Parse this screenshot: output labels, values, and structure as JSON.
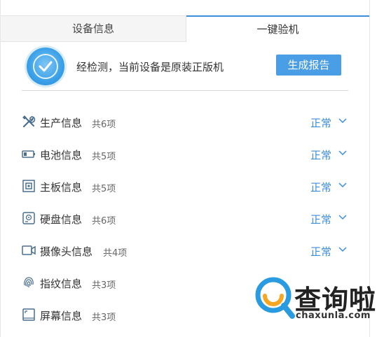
{
  "tabs": [
    {
      "label": "设备信息",
      "active": false
    },
    {
      "label": "一键验机",
      "active": true
    }
  ],
  "header": {
    "message": "经检测，当前设备是原装正版机",
    "report_button": "生成报告"
  },
  "rows": [
    {
      "icon": "tools-icon",
      "name": "生产信息",
      "count": "共6项",
      "status": "正常"
    },
    {
      "icon": "battery-icon",
      "name": "电池信息",
      "count": "共5项",
      "status": "正常"
    },
    {
      "icon": "motherboard-icon",
      "name": "主板信息",
      "count": "共5项",
      "status": "正常"
    },
    {
      "icon": "disk-icon",
      "name": "硬盘信息",
      "count": "共6项",
      "status": "正常"
    },
    {
      "icon": "camera-icon",
      "name": "摄像头信息",
      "count": "共4项",
      "status": "正常"
    },
    {
      "icon": "fingerprint-icon",
      "name": "指纹信息",
      "count": "共3项",
      "status": ""
    },
    {
      "icon": "screen-icon",
      "name": "屏幕信息",
      "count": "共3项",
      "status": ""
    }
  ],
  "watermark": {
    "brand": "查询啦",
    "url": "chaxunla.com"
  },
  "colors": {
    "accent": "#3d8ed8",
    "button": "#4a9ee6",
    "watermark_blue": "#2a9be0",
    "watermark_orange": "#f5a623"
  }
}
